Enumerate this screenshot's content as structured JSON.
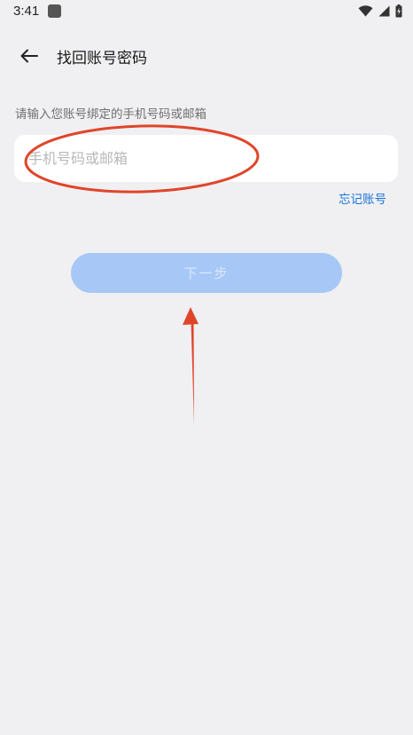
{
  "status_bar": {
    "time": "3:41"
  },
  "header": {
    "title": "找回账号密码"
  },
  "form": {
    "hint": "请输入您账号绑定的手机号码或邮箱",
    "input_placeholder": "手机号码或邮箱",
    "forgot_account_label": "忘记账号",
    "next_button_label": "下一步"
  },
  "icons": {
    "back": "arrow-left-icon",
    "wifi": "wifi-icon",
    "cell": "cell-signal-icon",
    "battery": "battery-icon"
  },
  "colors": {
    "background": "#f0f0f2",
    "link": "#1a73d9",
    "button_disabled": "#a7c8f6",
    "annotation": "#e0452a"
  }
}
